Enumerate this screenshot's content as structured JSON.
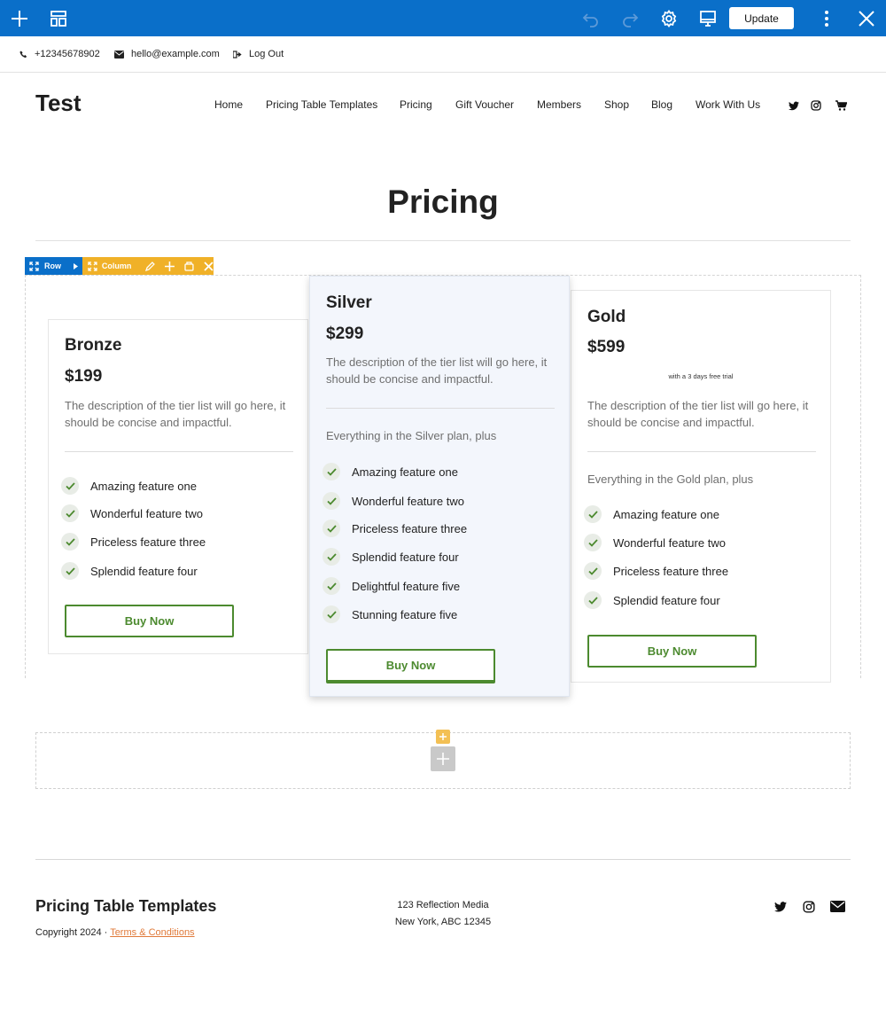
{
  "builder": {
    "update_label": "Update",
    "row_label": "Row",
    "column_label": "Column",
    "accent": "#0a6fc9",
    "column_accent": "#f0b128"
  },
  "topbar": {
    "phone": "+12345678902",
    "email": "hello@example.com",
    "logout": "Log Out"
  },
  "header": {
    "logo": "Test",
    "nav": [
      "Home",
      "Pricing Table Templates",
      "Pricing",
      "Gift Voucher",
      "Members",
      "Shop",
      "Blog",
      "Work With Us"
    ]
  },
  "page": {
    "title": "Pricing"
  },
  "plans": [
    {
      "name": "Bronze",
      "price": "$199",
      "description": "The description of the tier list will go here, it should be concise and impactful.",
      "features": [
        "Amazing feature one",
        "Wonderful feature two",
        "Priceless feature three",
        "Splendid feature four"
      ],
      "button": "Buy Now"
    },
    {
      "name": "Silver",
      "price": "$299",
      "description": "The description of the tier list will go here, it should be concise and impactful.",
      "includes": "Everything in the Silver plan, plus",
      "features": [
        "Amazing feature one",
        "Wonderful feature two",
        "Priceless feature three",
        "Splendid feature four",
        "Delightful feature five",
        "Stunning feature five"
      ],
      "button": "Buy Now"
    },
    {
      "name": "Gold",
      "price": "$599",
      "trial": "with a 3 days free trial",
      "description": "The description of the tier list will go here, it should be concise and impactful.",
      "includes": "Everything in the Gold plan, plus",
      "features": [
        "Amazing feature one",
        "Wonderful feature two",
        "Priceless feature three",
        "Splendid feature four"
      ],
      "button": "Buy Now"
    }
  ],
  "footer": {
    "title": "Pricing Table Templates",
    "copyright": "Copyright 2024 · ",
    "terms": "Terms & Conditions",
    "address_line1": "123 Reflection Media",
    "address_line2": "New York, ABC 12345"
  },
  "colors": {
    "button_green": "#4c8a2f",
    "link_orange": "#e07a3a"
  }
}
